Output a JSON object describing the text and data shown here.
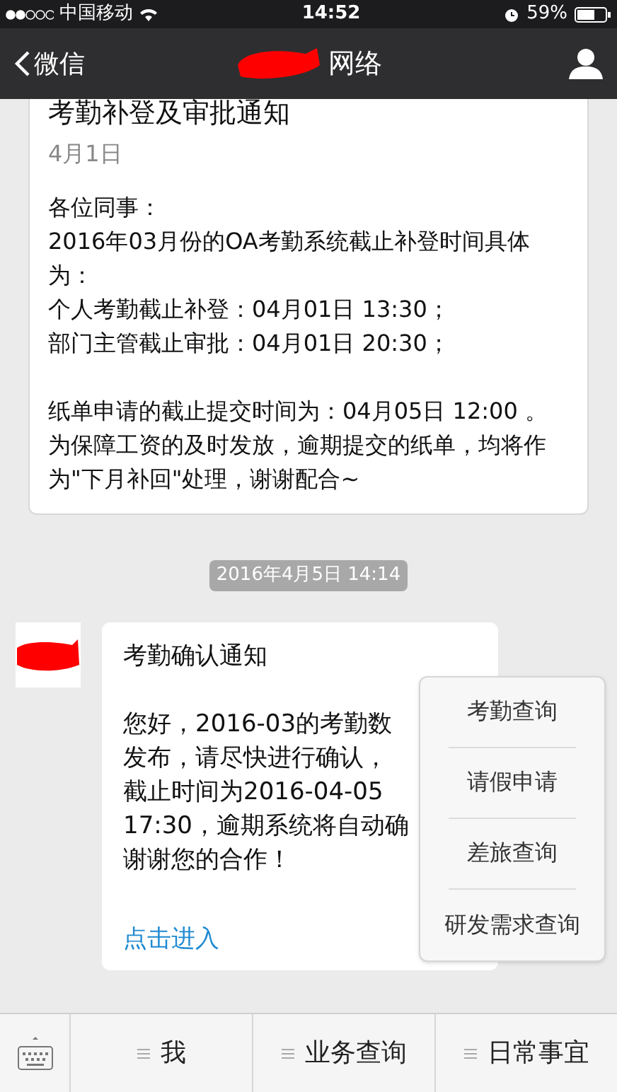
{
  "status_bar": {
    "carrier": "中国移动",
    "time": "14:52",
    "battery": "59%"
  },
  "nav": {
    "back": "微信",
    "title": "网络"
  },
  "messages": [
    {
      "kind": "article",
      "title": "考勤补登及审批通知",
      "date": "4月1日",
      "lines": [
        "各位同事：",
        "2016年03月份的OA考勤系统截止补登时间具体为：",
        "个人考勤截止补登：04月01日 13:30；",
        "部门主管截止审批：04月01日 20:30；"
      ],
      "paragraph": "纸单申请的截止提交时间为：04月05日 12:00 。为保障工资的及时发放，逾期提交的纸单，均将作为\"下月补回\"处理，谢谢配合~"
    },
    {
      "kind": "timestamp",
      "text": "2016年4月5日 14:14"
    },
    {
      "kind": "notice",
      "title": "考勤确认通知",
      "lines": [
        "您好，2016-03的考勤数",
        "发布，请尽快进行确认，",
        "截止时间为2016-04-05",
        "17:30，逾期系统将自动确",
        "谢谢您的合作！"
      ],
      "link": "点击进入"
    }
  ],
  "bottom_menu": [
    {
      "label": "我"
    },
    {
      "label": "业务查询"
    },
    {
      "label": "日常事宜",
      "submenu": [
        "考勤查询",
        "请假申请",
        "差旅查询",
        "研发需求查询"
      ]
    }
  ]
}
